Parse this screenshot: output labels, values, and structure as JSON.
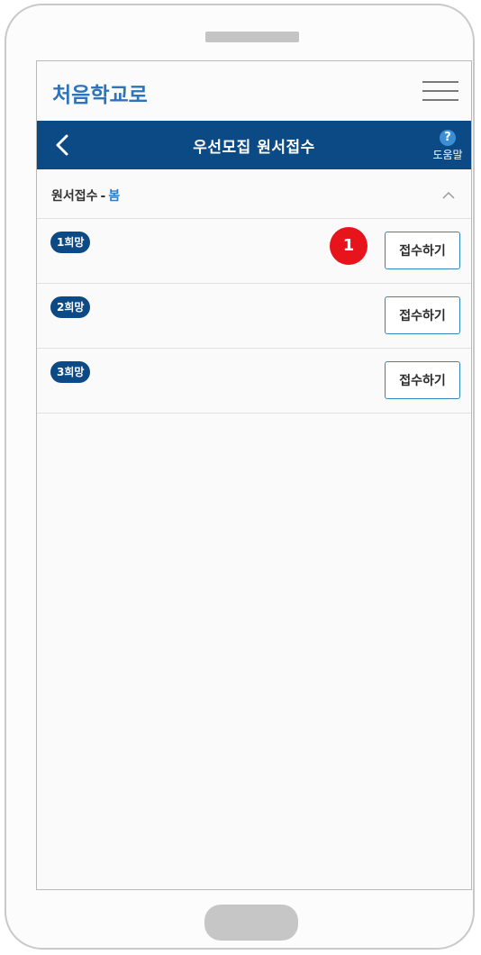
{
  "logo": {
    "text": "처음학교로"
  },
  "header": {
    "title": "우선모집 원서접수",
    "help_label": "도움말",
    "help_symbol": "?"
  },
  "section": {
    "title": "원서접수",
    "separator": "-",
    "season": "봄"
  },
  "rows": [
    {
      "badge": "1희망",
      "button": "접수하기"
    },
    {
      "badge": "2희망",
      "button": "접수하기"
    },
    {
      "badge": "3희망",
      "button": "접수하기"
    }
  ],
  "marker": {
    "number": "1"
  },
  "colors": {
    "header_bg": "#0b4a85",
    "badge_bg": "#0b4a85",
    "marker": "#e8141c",
    "accent": "#2a7ec9"
  },
  "icons": [
    "back-arrow-icon",
    "help-icon",
    "hamburger-menu-icon",
    "chevron-up-icon"
  ]
}
